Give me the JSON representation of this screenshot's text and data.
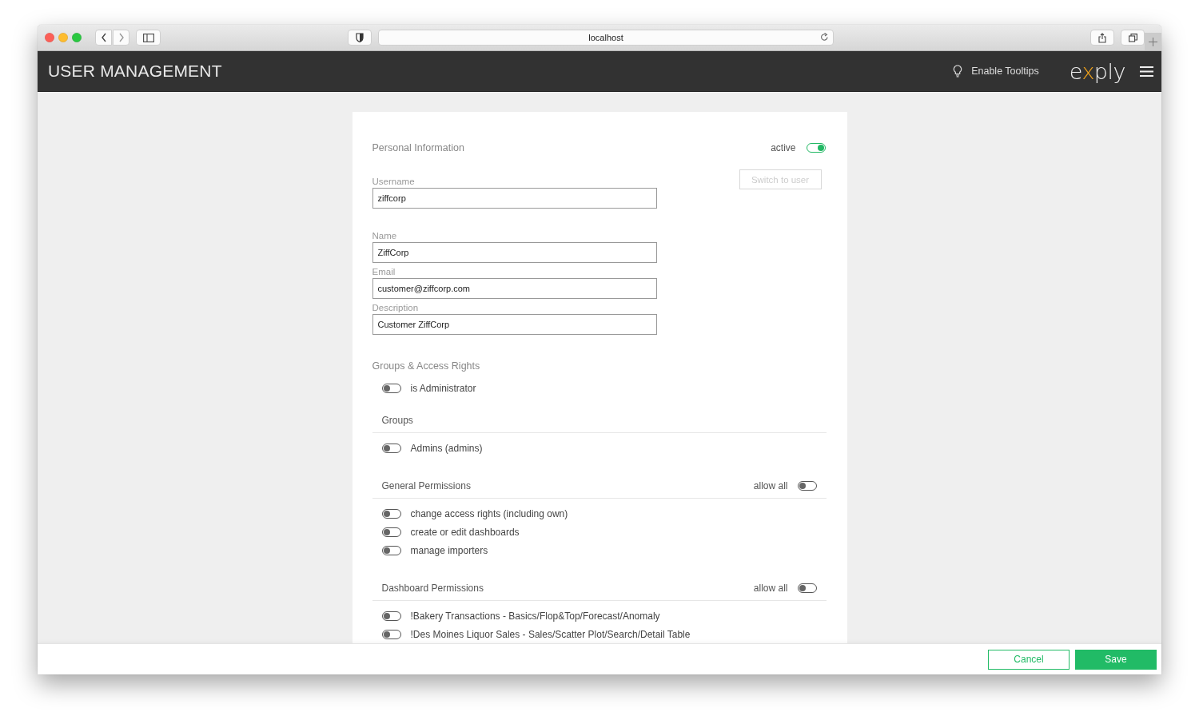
{
  "browser": {
    "url": "localhost"
  },
  "header": {
    "title": "USER MANAGEMENT",
    "tooltips_label": "Enable Tooltips",
    "logo": "exply"
  },
  "personal": {
    "heading": "Personal Information",
    "active": {
      "label": "active",
      "on": true
    },
    "switch_button": {
      "label": "Switch to user",
      "disabled": true
    },
    "fields": [
      {
        "label": "Username",
        "value": "ziffcorp"
      },
      {
        "label": "Name",
        "value": "ZiffCorp"
      },
      {
        "label": "Email",
        "value": "customer@ziffcorp.com"
      },
      {
        "label": "Description",
        "value": "Customer ZiffCorp"
      }
    ]
  },
  "groups_access": {
    "heading": "Groups & Access Rights",
    "admin": {
      "label": "is Administrator",
      "on": false
    },
    "sections": [
      {
        "title": "Groups",
        "items": [
          {
            "label": "Admins (admins)",
            "on": false
          }
        ]
      },
      {
        "title": "General Permissions",
        "allow_all": {
          "label": "allow all",
          "on": false
        },
        "items": [
          {
            "label": "change access rights (including own)",
            "on": false
          },
          {
            "label": "create or edit dashboards",
            "on": false
          },
          {
            "label": "manage importers",
            "on": false
          }
        ]
      },
      {
        "title": "Dashboard Permissions",
        "allow_all": {
          "label": "allow all",
          "on": false
        },
        "items": [
          {
            "label": "!Bakery Transactions - Basics/Flop&Top/Forecast/Anomaly",
            "on": false
          },
          {
            "label": "!Des Moines Liquor Sales - Sales/Scatter Plot/Search/Detail Table",
            "on": false
          }
        ]
      }
    ]
  },
  "footer": {
    "buttons": [
      {
        "label": "Cancel",
        "kind": "secondary"
      },
      {
        "label": "Save",
        "kind": "primary"
      }
    ]
  }
}
